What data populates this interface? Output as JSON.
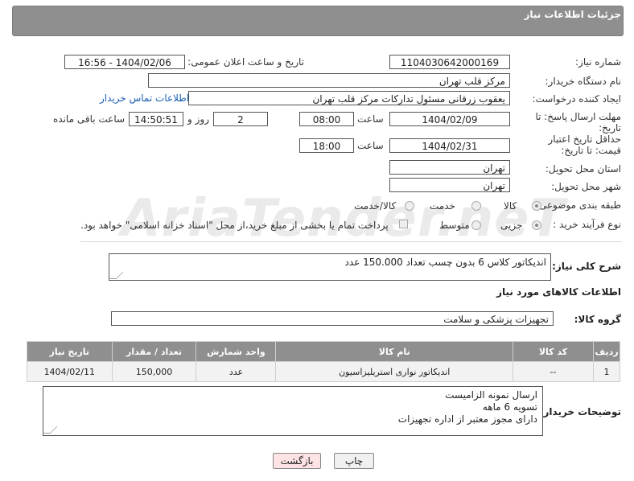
{
  "header": {
    "title": "جزئیات اطلاعات نیاز"
  },
  "labels": {
    "need_number": "شماره نیاز:",
    "announce_datetime": "تاریخ و ساعت اعلان عمومی:",
    "buyer_org": "نام دستگاه خریدار:",
    "requester": "ایجاد کننده درخواست:",
    "buyer_contact": "اطلاعات تماس خریدار",
    "reply_deadline": "مهلت ارسال پاسخ: تا تاریخ:",
    "price_validity": "حداقل تاریخ اعتبار قیمت: تا تاریخ:",
    "time": "ساعت",
    "day_and": "روز و",
    "remaining": "ساعت باقی مانده",
    "province": "استان محل تحویل:",
    "city": "شهر محل تحویل:",
    "category": "طبقه بندی موضوعی:",
    "process_type": "نوع فرآیند خرید :",
    "description": "شرح کلی نیاز:",
    "goods_info": "اطلاعات کالاهای مورد نیاز",
    "goods_group": "گروه کالا:",
    "buyer_notes": "توضیحات خریدار:"
  },
  "values": {
    "need_number": "1104030642000169",
    "announce_datetime": "1404/02/06 - 16:56",
    "buyer_org": "مرکز قلب تهران",
    "requester": "یعقوب زرقانی مسئول تدارکات مرکز قلب تهران",
    "reply_date": "1404/02/09",
    "reply_time": "08:00",
    "reply_days": "2",
    "reply_remaining": "14:50:51",
    "validity_date": "1404/02/31",
    "validity_time": "18:00",
    "province": "تهران",
    "city": "تهران",
    "description": "اندیکاتور کلاس 6 بدون چسب تعداد 150.000 عدد",
    "goods_group": "تجهیزات پزشکی و سلامت",
    "buyer_notes": [
      "ارسال نمونه الزامیست",
      "تسویه 6 ماهه",
      "دارای مجوز معتبر از اداره تجهیزات"
    ]
  },
  "category_options": [
    {
      "label": "کالا",
      "selected": true
    },
    {
      "label": "خدمت",
      "selected": false
    },
    {
      "label": "کالا/خدمت",
      "selected": false
    }
  ],
  "process_options": [
    {
      "label": "جزیی",
      "selected": true
    },
    {
      "label": "متوسط",
      "selected": false
    }
  ],
  "payment_note": "پرداخت تمام یا بخشی از مبلغ خرید،از محل \"اسناد خزانه اسلامی\" خواهد بود.",
  "table": {
    "headers": [
      "ردیف",
      "کد کالا",
      "نام کالا",
      "واحد شمارش",
      "تعداد / مقدار",
      "تاریخ نیاز"
    ],
    "rows": [
      [
        "1",
        "--",
        "اندیکاتور نواری استریلیزاسیون",
        "عدد",
        "150,000",
        "1404/02/11"
      ]
    ]
  },
  "buttons": {
    "print": "چاپ",
    "back": "بازگشت"
  },
  "watermark": "AriaTender.neT",
  "colors": {
    "header_bg": "#8f8f8f",
    "link": "#1a5fb4",
    "back_button_bg": "#fde3e3"
  }
}
